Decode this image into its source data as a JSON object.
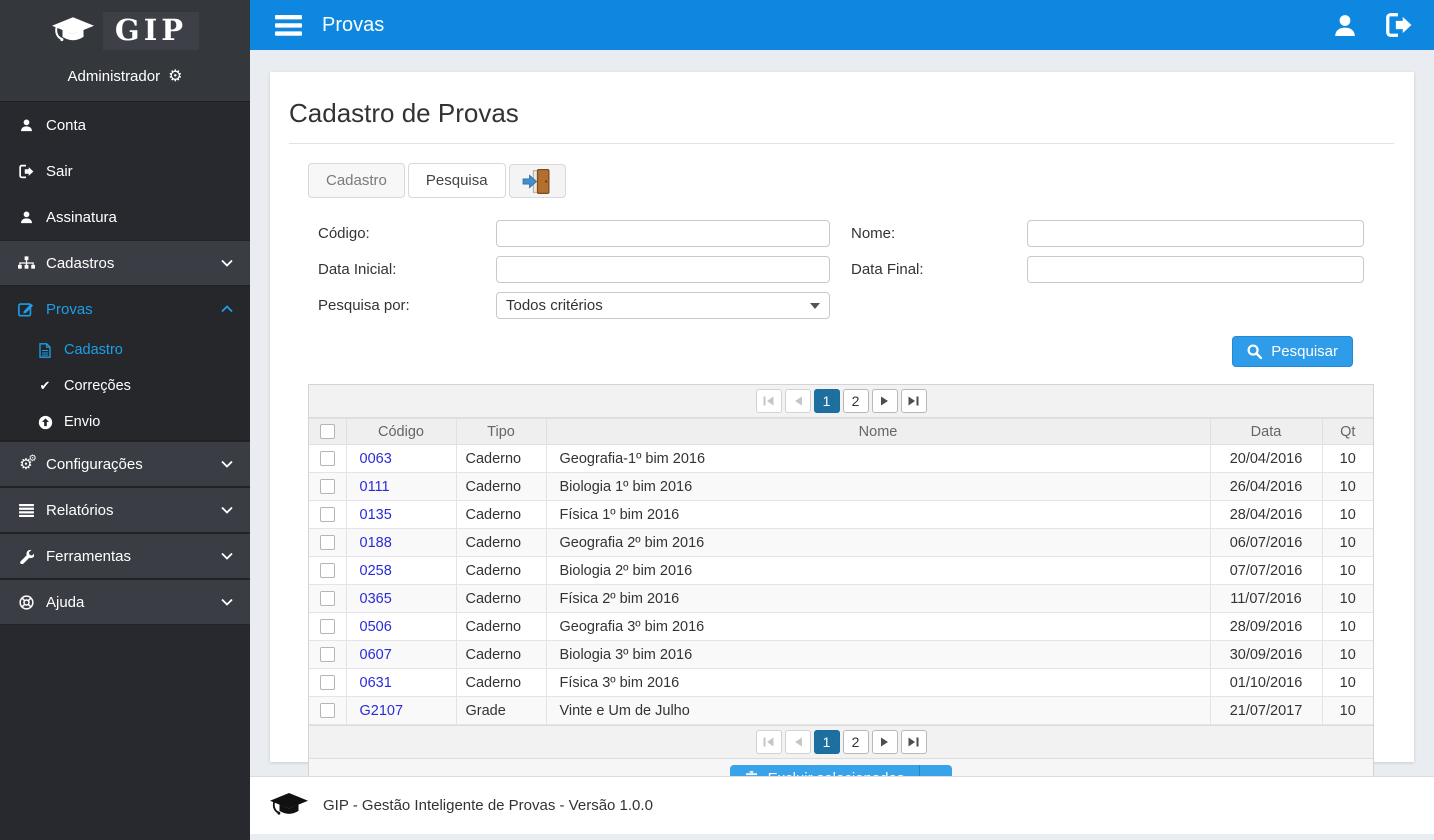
{
  "sidebar": {
    "brand": "GIP",
    "role": "Administrador",
    "items": [
      {
        "label": "Conta"
      },
      {
        "label": "Sair"
      },
      {
        "label": "Assinatura"
      },
      {
        "label": "Cadastros"
      },
      {
        "label": "Provas"
      },
      {
        "label": "Cadastro"
      },
      {
        "label": "Correções"
      },
      {
        "label": "Envio"
      },
      {
        "label": "Configurações"
      },
      {
        "label": "Relatórios"
      },
      {
        "label": "Ferramentas"
      },
      {
        "label": "Ajuda"
      }
    ]
  },
  "topbar": {
    "title": "Provas"
  },
  "page": {
    "title": "Cadastro de Provas",
    "tabs": {
      "cadastro": "Cadastro",
      "pesquisa": "Pesquisa"
    }
  },
  "form": {
    "labels": {
      "codigo": "Código:",
      "nome": "Nome:",
      "data_inicial": "Data Inicial:",
      "data_final": "Data Final:",
      "pesquisa_por": "Pesquisa por:"
    },
    "select_value": "Todos critérios",
    "search_button": "Pesquisar"
  },
  "pagination": {
    "pages": [
      "1",
      "2"
    ],
    "active": "1"
  },
  "table": {
    "headers": {
      "codigo": "Código",
      "tipo": "Tipo",
      "nome": "Nome",
      "data": "Data",
      "qt": "Qt"
    },
    "rows": [
      {
        "codigo": "0063",
        "tipo": "Caderno",
        "nome": "Geografia-1º bim 2016",
        "data": "20/04/2016",
        "qt": "10"
      },
      {
        "codigo": "0111",
        "tipo": "Caderno",
        "nome": "Biologia 1º bim 2016",
        "data": "26/04/2016",
        "qt": "10"
      },
      {
        "codigo": "0135",
        "tipo": "Caderno",
        "nome": "Física 1º bim 2016",
        "data": "28/04/2016",
        "qt": "10"
      },
      {
        "codigo": "0188",
        "tipo": "Caderno",
        "nome": "Geografia 2º bim 2016",
        "data": "06/07/2016",
        "qt": "10"
      },
      {
        "codigo": "0258",
        "tipo": "Caderno",
        "nome": "Biologia 2º bim 2016",
        "data": "07/07/2016",
        "qt": "10"
      },
      {
        "codigo": "0365",
        "tipo": "Caderno",
        "nome": "Física 2º bim 2016",
        "data": "11/07/2016",
        "qt": "10"
      },
      {
        "codigo": "0506",
        "tipo": "Caderno",
        "nome": "Geografia 3º bim 2016",
        "data": "28/09/2016",
        "qt": "10"
      },
      {
        "codigo": "0607",
        "tipo": "Caderno",
        "nome": "Biologia 3º bim 2016",
        "data": "30/09/2016",
        "qt": "10"
      },
      {
        "codigo": "0631",
        "tipo": "Caderno",
        "nome": "Física 3º bim 2016",
        "data": "01/10/2016",
        "qt": "10"
      },
      {
        "codigo": "G2107",
        "tipo": "Grade",
        "nome": "Vinte e Um de Julho",
        "data": "21/07/2017",
        "qt": "10"
      }
    ]
  },
  "actions": {
    "delete_button": "Excluir selecionados"
  },
  "footer": {
    "text": "GIP  -  Gestão Inteligente de Provas - Versão 1.0.0"
  },
  "icons": {
    "graduation-cap": "mortarboard shape",
    "gear": "⚙",
    "user": "person silhouette",
    "sign-out": "door with right arrow",
    "sitemap": "org-tree squares",
    "edit": "pencil over square",
    "file": "document sheet",
    "check": "✔",
    "upload": "arrow in circle",
    "cogs": "two gears",
    "list": "stacked bars",
    "wrench": "wrench",
    "help": "life ring",
    "search": "magnifier",
    "trash": "trash can",
    "door": "brown door with blue enter arrow",
    "caret-down": "▼"
  },
  "colors": {
    "topbar": "#0d87e0",
    "accent": "#1e9ee9",
    "primary_button": "#2e9ce9",
    "delete_button": "#38a3e8",
    "pagination_active": "#1d6fa0",
    "link": "#2b2bd6",
    "sidebar_bg": "#27292e",
    "sidebar_band": "#3a3e44"
  }
}
